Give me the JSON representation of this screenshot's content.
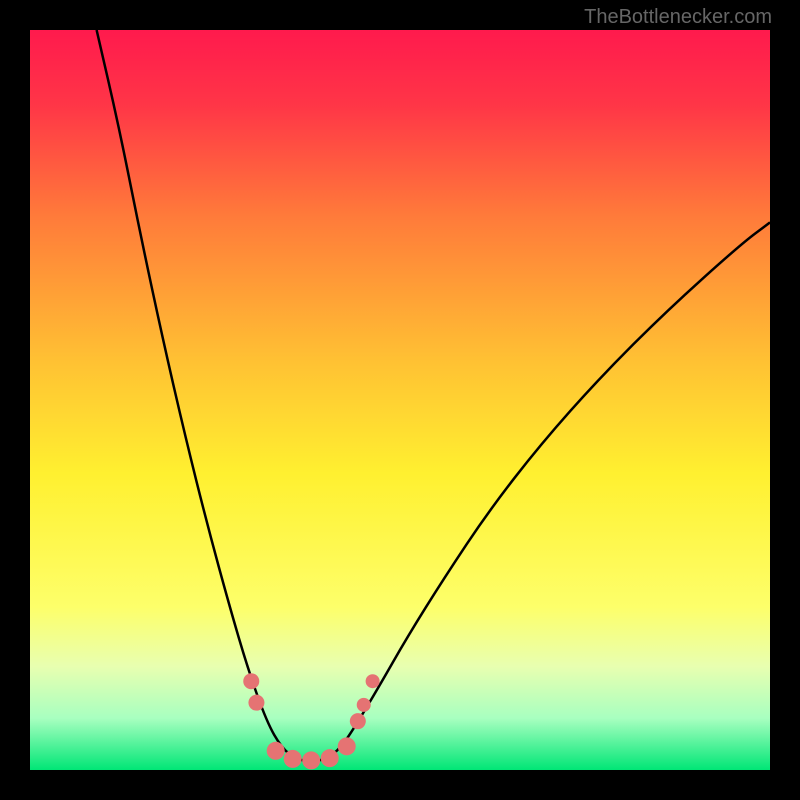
{
  "watermark": "TheBottlenecker.com",
  "chart_data": {
    "type": "line",
    "title": "",
    "xlabel": "",
    "ylabel": "",
    "xlim": [
      0,
      100
    ],
    "ylim": [
      0,
      100
    ],
    "background": {
      "type": "vertical_gradient",
      "stops": [
        {
          "offset": 0.0,
          "color": "#ff1a4d"
        },
        {
          "offset": 0.1,
          "color": "#ff3547"
        },
        {
          "offset": 0.25,
          "color": "#ff7a3a"
        },
        {
          "offset": 0.45,
          "color": "#ffc233"
        },
        {
          "offset": 0.6,
          "color": "#fff030"
        },
        {
          "offset": 0.78,
          "color": "#fdff6a"
        },
        {
          "offset": 0.86,
          "color": "#e8ffb0"
        },
        {
          "offset": 0.93,
          "color": "#a8ffc0"
        },
        {
          "offset": 1.0,
          "color": "#00e676"
        }
      ]
    },
    "curve": {
      "description": "V-shaped bottleneck curve, asymmetric, steeper descent on the left",
      "points": [
        {
          "x": 9.0,
          "y": 100.0
        },
        {
          "x": 12.0,
          "y": 87.0
        },
        {
          "x": 15.0,
          "y": 72.0
        },
        {
          "x": 18.0,
          "y": 58.0
        },
        {
          "x": 21.0,
          "y": 45.0
        },
        {
          "x": 24.0,
          "y": 33.0
        },
        {
          "x": 27.0,
          "y": 22.0
        },
        {
          "x": 29.5,
          "y": 13.5
        },
        {
          "x": 32.0,
          "y": 6.5
        },
        {
          "x": 34.0,
          "y": 3.0
        },
        {
          "x": 36.0,
          "y": 1.4
        },
        {
          "x": 38.0,
          "y": 1.2
        },
        {
          "x": 40.0,
          "y": 1.4
        },
        {
          "x": 42.0,
          "y": 3.0
        },
        {
          "x": 44.0,
          "y": 6.0
        },
        {
          "x": 47.0,
          "y": 11.0
        },
        {
          "x": 51.0,
          "y": 18.0
        },
        {
          "x": 56.0,
          "y": 26.0
        },
        {
          "x": 62.0,
          "y": 35.0
        },
        {
          "x": 69.0,
          "y": 44.0
        },
        {
          "x": 77.0,
          "y": 53.0
        },
        {
          "x": 86.0,
          "y": 62.0
        },
        {
          "x": 96.0,
          "y": 71.0
        },
        {
          "x": 100.0,
          "y": 74.0
        }
      ]
    },
    "markers": {
      "color": "#e57373",
      "radius_main": 9,
      "radius_small": 7,
      "points": [
        {
          "x": 29.9,
          "y": 12.0,
          "r": 8
        },
        {
          "x": 30.6,
          "y": 9.1,
          "r": 8
        },
        {
          "x": 33.2,
          "y": 2.6,
          "r": 9
        },
        {
          "x": 35.5,
          "y": 1.5,
          "r": 9
        },
        {
          "x": 38.0,
          "y": 1.3,
          "r": 9
        },
        {
          "x": 40.5,
          "y": 1.6,
          "r": 9
        },
        {
          "x": 42.8,
          "y": 3.2,
          "r": 9
        },
        {
          "x": 44.3,
          "y": 6.6,
          "r": 8
        },
        {
          "x": 45.1,
          "y": 8.8,
          "r": 7
        },
        {
          "x": 46.3,
          "y": 12.0,
          "r": 7
        }
      ]
    }
  }
}
